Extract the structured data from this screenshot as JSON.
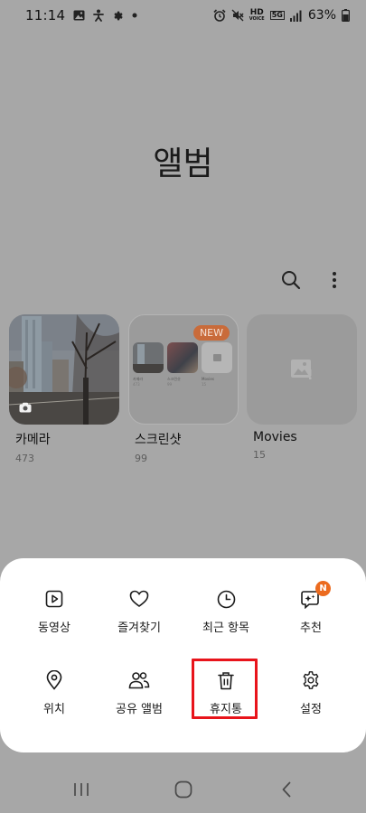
{
  "status_bar": {
    "time": "11:14",
    "battery": "63%",
    "left_icons": [
      "gallery-icon",
      "accessibility-icon",
      "gear-icon",
      "dot-icon"
    ],
    "right_icons": [
      "alarm-icon",
      "mute-icon",
      "hd-voice-icon",
      "5g-icon",
      "signal-icon",
      "battery-icon"
    ],
    "hd_label": "HD",
    "fiveg_label": "5G"
  },
  "page": {
    "title": "앨범"
  },
  "toolbar": {
    "icons": [
      "search-icon",
      "more-vertical-icon"
    ]
  },
  "albums": [
    {
      "name": "카메라",
      "count": "473"
    },
    {
      "name": "스크린샷",
      "count": "99",
      "badge": "NEW"
    },
    {
      "name": "Movies",
      "count": "15"
    }
  ],
  "screenshot_preview": {
    "mini_labels": [
      "카메라",
      "스크린샷",
      "Movies"
    ],
    "mini_counts": [
      "473",
      "99",
      "15"
    ]
  },
  "menu": {
    "items": [
      {
        "label": "동영상",
        "icon": "video-play-icon"
      },
      {
        "label": "즐겨찾기",
        "icon": "heart-icon"
      },
      {
        "label": "최근 항목",
        "icon": "clock-icon"
      },
      {
        "label": "추천",
        "icon": "sparkle-chat-icon",
        "badge": "N"
      },
      {
        "label": "위치",
        "icon": "location-pin-icon"
      },
      {
        "label": "공유 앨범",
        "icon": "people-icon"
      },
      {
        "label": "휴지통",
        "icon": "trash-icon",
        "highlighted": true
      },
      {
        "label": "설정",
        "icon": "settings-gear-icon"
      }
    ]
  },
  "nav_bar": {
    "buttons": [
      "recent-apps-button",
      "home-button",
      "back-button"
    ]
  },
  "colors": {
    "overlay_background": "#a7a7a7",
    "sheet": "#ffffff",
    "highlight": "#e8141b",
    "badge_orange": "#ec6b1f",
    "new_badge": "#c96b3a"
  }
}
